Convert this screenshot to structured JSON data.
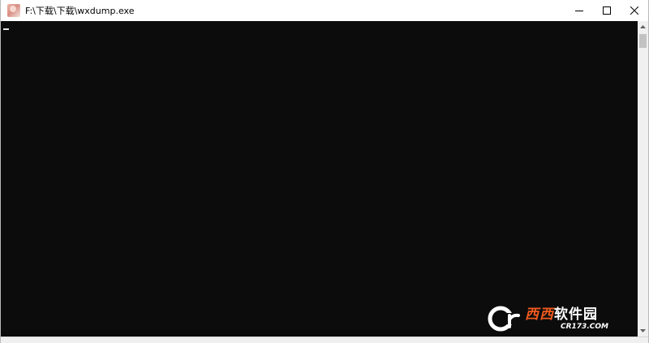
{
  "window": {
    "title": "F:\\下载\\下载\\wxdump.exe",
    "controls": [
      "minimize",
      "maximize",
      "close"
    ]
  },
  "console": {
    "background": "#0c0c0c",
    "cursor_color": "#e6e6e6",
    "lines": []
  },
  "watermark": {
    "brand_accent": "西西",
    "brand_rest": "软件园",
    "url": "CR173.COM",
    "accent_color": "#f05a1e"
  },
  "icons": {
    "app": "wxdump-app-icon",
    "minimize": "minimize-icon",
    "maximize": "maximize-icon",
    "close": "close-icon",
    "scroll_up": "scroll-up-arrow-icon",
    "scroll_down": "scroll-down-arrow-icon"
  }
}
